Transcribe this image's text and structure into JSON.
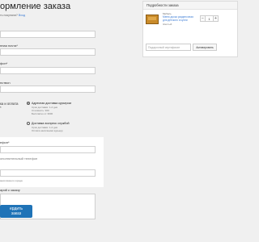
{
  "page": {
    "title": "ормление заказа",
    "login_hint_prefix": "ть покупали? ",
    "login_link": "Вход"
  },
  "form": {
    "labels": {
      "email": "",
      "company": "нная почта*",
      "phone": "фон*",
      "address": "нствоn"
    },
    "delivery_label_1": "ка и оплата",
    "delivery_label_2": "*",
    "delivery_options": [
      {
        "title": "Адресная доставка курьером",
        "line1": "Срок доставки: 1-2 дня",
        "line2": "Стоимость: 300",
        "line3": "Бесплатно от 3000",
        "selected": true
      },
      {
        "title": "Доставка экспресс службой",
        "line1": "Срок доставки: 1-2 дня",
        "line2": "Оплата наличными курьеру",
        "selected": false
      }
    ],
    "phone2_label": "ефон*",
    "alt_phone_label": "ополнительный телефон",
    "hint": "ания вашего города",
    "comment_label": "арий к заказу",
    "submit_label": "ердить заказ"
  },
  "order": {
    "header": "Подробности заказа",
    "item": {
      "category": "Мебель",
      "name": "Меню доска разделочная для детского и кухни",
      "color": "Желтый",
      "quantity": "1"
    },
    "coupon_placeholder": "Подарочный сертификат",
    "activate_label": "Активировать"
  }
}
